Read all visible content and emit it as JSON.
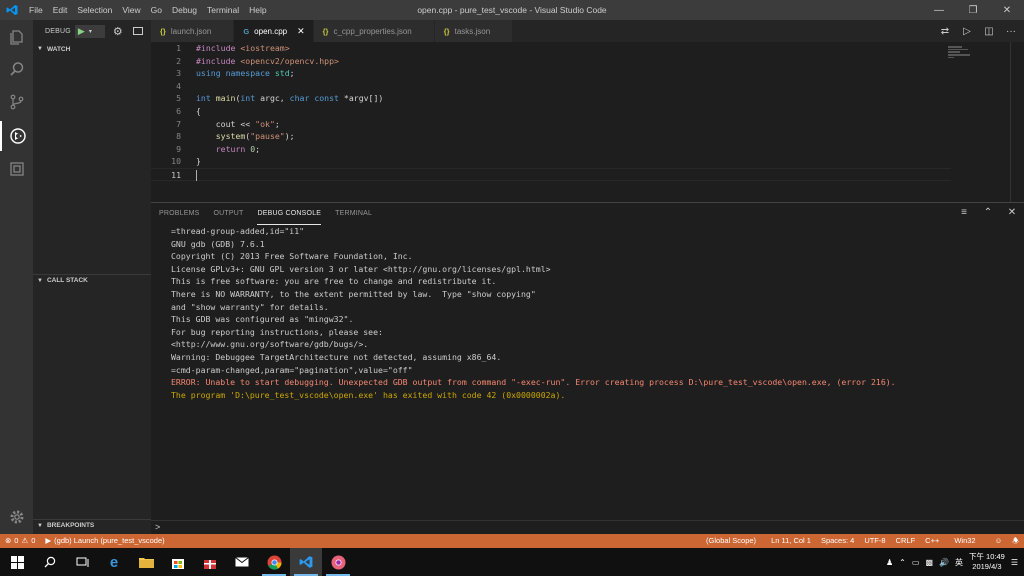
{
  "titlebar": {
    "menus": [
      "File",
      "Edit",
      "Selection",
      "View",
      "Go",
      "Debug",
      "Terminal",
      "Help"
    ],
    "title": "open.cpp - pure_test_vscode - Visual Studio Code"
  },
  "sidebar": {
    "debug_label": "DEBUG",
    "sections": {
      "watch": "WATCH",
      "call_stack": "CALL STACK",
      "breakpoints": "BREAKPOINTS"
    }
  },
  "tabs": [
    {
      "icon": "{}",
      "label": "launch.json",
      "active": false
    },
    {
      "icon": "G",
      "label": "open.cpp",
      "active": true
    },
    {
      "icon": "{}",
      "label": "c_cpp_properties.json",
      "active": false
    },
    {
      "icon": "{}",
      "label": "tasks.json",
      "active": false
    }
  ],
  "colors": {
    "accent": "#0098ff",
    "statusbar_debug": "#cc6633",
    "error_text": "#f48771"
  },
  "code_lines": [
    {
      "n": "1",
      "tokens": [
        [
          "pp",
          "#include "
        ],
        [
          "str",
          "<iostream>"
        ]
      ]
    },
    {
      "n": "2",
      "tokens": [
        [
          "pp",
          "#include "
        ],
        [
          "str",
          "<opencv2/opencv.hpp>"
        ]
      ]
    },
    {
      "n": "3",
      "tokens": [
        [
          "kw",
          "using namespace "
        ],
        [
          "ty",
          "std"
        ],
        [
          "",
          "; "
        ]
      ]
    },
    {
      "n": "4",
      "tokens": []
    },
    {
      "n": "5",
      "tokens": [
        [
          "kw",
          "int "
        ],
        [
          "fn",
          "main"
        ],
        [
          "",
          "("
        ],
        [
          "kw",
          "int "
        ],
        [
          "",
          "argc, "
        ],
        [
          "kw",
          "char const "
        ],
        [
          "",
          "*argv[])"
        ]
      ]
    },
    {
      "n": "6",
      "tokens": [
        [
          "",
          "{"
        ]
      ]
    },
    {
      "n": "7",
      "tokens": [
        [
          "",
          "    cout << "
        ],
        [
          "str",
          "\"ok\""
        ],
        [
          "",
          ";"
        ]
      ]
    },
    {
      "n": "8",
      "tokens": [
        [
          "",
          "    "
        ],
        [
          "fn",
          "system"
        ],
        [
          "",
          "("
        ],
        [
          "str",
          "\"pause\""
        ],
        [
          "",
          ");"
        ]
      ]
    },
    {
      "n": "9",
      "tokens": [
        [
          "",
          "    "
        ],
        [
          "pp",
          "return "
        ],
        [
          "num",
          "0"
        ],
        [
          "",
          ";"
        ]
      ]
    },
    {
      "n": "10",
      "tokens": [
        [
          "",
          "}"
        ]
      ]
    },
    {
      "n": "11",
      "tokens": [],
      "current": true
    }
  ],
  "panel": {
    "tabs": [
      "PROBLEMS",
      "OUTPUT",
      "DEBUG CONSOLE",
      "TERMINAL"
    ],
    "active_tab": "DEBUG CONSOLE",
    "console_lines": [
      {
        "t": "=thread-group-added,id=\"i1\"",
        "k": ""
      },
      {
        "t": "GNU gdb (GDB) 7.6.1",
        "k": ""
      },
      {
        "t": "Copyright (C) 2013 Free Software Foundation, Inc.",
        "k": ""
      },
      {
        "t": "License GPLv3+: GNU GPL version 3 or later <http://gnu.org/licenses/gpl.html>",
        "k": ""
      },
      {
        "t": "This is free software: you are free to change and redistribute it.",
        "k": ""
      },
      {
        "t": "There is NO WARRANTY, to the extent permitted by law.  Type \"show copying\"",
        "k": ""
      },
      {
        "t": "and \"show warranty\" for details.",
        "k": ""
      },
      {
        "t": "This GDB was configured as \"mingw32\".",
        "k": ""
      },
      {
        "t": "For bug reporting instructions, please see:",
        "k": ""
      },
      {
        "t": "<http://www.gnu.org/software/gdb/bugs/>.",
        "k": ""
      },
      {
        "t": "Warning: Debuggee TargetArchitecture not detected, assuming x86_64.",
        "k": ""
      },
      {
        "t": "=cmd-param-changed,param=\"pagination\",value=\"off\"",
        "k": ""
      },
      {
        "t": "ERROR: Unable to start debugging. Unexpected GDB output from command \"-exec-run\". Error creating process D:\\pure_test_vscode\\open.exe, (error 216).",
        "k": "err"
      },
      {
        "t": "The program 'D:\\pure_test_vscode\\open.exe' has exited with code 42 (0x0000002a).",
        "k": "warn"
      }
    ],
    "repl_prompt": ">"
  },
  "statusbar": {
    "errors": "0",
    "warnings": "0",
    "launch": "(gdb) Launch (pure_test_vscode)",
    "scope": "(Global Scope)",
    "position": "Ln 11, Col 1",
    "spaces": "Spaces: 4",
    "encoding": "UTF-8",
    "eol": "CRLF",
    "language": "C++",
    "platform": "Win32"
  },
  "taskbar": {
    "ime": "英",
    "time": "下午 10:49",
    "date": "2019/4/3"
  }
}
